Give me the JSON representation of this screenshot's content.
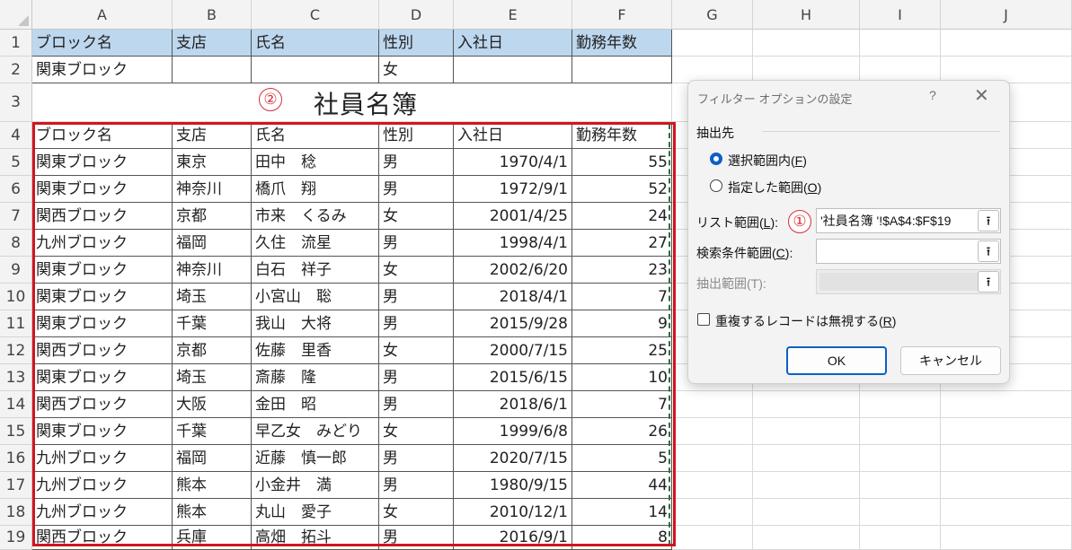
{
  "columns": [
    "A",
    "B",
    "C",
    "D",
    "E",
    "F",
    "G",
    "H",
    "I",
    "J"
  ],
  "rows": [
    "1",
    "2",
    "3",
    "4",
    "5",
    "6",
    "7",
    "8",
    "9",
    "10",
    "11",
    "12",
    "13",
    "14",
    "15",
    "16",
    "17",
    "18",
    "19"
  ],
  "criteria": {
    "headers": [
      "ブロック名",
      "支店",
      "氏名",
      "性別",
      "入社日",
      "勤務年数"
    ],
    "values": [
      "関東ブロック",
      "",
      "",
      "女",
      "",
      ""
    ]
  },
  "title": "社員名簿",
  "badge_title": "②",
  "table": {
    "headers": [
      "ブロック名",
      "支店",
      "氏名",
      "性別",
      "入社日",
      "勤務年数"
    ],
    "rows": [
      [
        "関東ブロック",
        "東京",
        "田中　稔",
        "男",
        "1970/4/1",
        "55"
      ],
      [
        "関東ブロック",
        "神奈川",
        "橋爪　翔",
        "男",
        "1972/9/1",
        "52"
      ],
      [
        "関西ブロック",
        "京都",
        "市来　くるみ",
        "女",
        "2001/4/25",
        "24"
      ],
      [
        "九州ブロック",
        "福岡",
        "久住　流星",
        "男",
        "1998/4/1",
        "27"
      ],
      [
        "関東ブロック",
        "神奈川",
        "白石　祥子",
        "女",
        "2002/6/20",
        "23"
      ],
      [
        "関東ブロック",
        "埼玉",
        "小宮山　聡",
        "男",
        "2018/4/1",
        "7"
      ],
      [
        "関東ブロック",
        "千葉",
        "我山　大将",
        "男",
        "2015/9/28",
        "9"
      ],
      [
        "関西ブロック",
        "京都",
        "佐藤　里香",
        "女",
        "2000/7/15",
        "25"
      ],
      [
        "関東ブロック",
        "埼玉",
        "斎藤　隆",
        "男",
        "2015/6/15",
        "10"
      ],
      [
        "関西ブロック",
        "大阪",
        "金田　昭",
        "男",
        "2018/6/1",
        "7"
      ],
      [
        "関東ブロック",
        "千葉",
        "早乙女　みどり",
        "女",
        "1999/6/8",
        "26"
      ],
      [
        "九州ブロック",
        "福岡",
        "近藤　慎一郎",
        "男",
        "2020/7/15",
        "5"
      ],
      [
        "九州ブロック",
        "熊本",
        "小金井　満",
        "男",
        "1980/9/15",
        "44"
      ],
      [
        "九州ブロック",
        "熊本",
        "丸山　愛子",
        "女",
        "2010/12/1",
        "14"
      ],
      [
        "関西ブロック",
        "兵庫",
        "高畑　拓斗",
        "男",
        "2016/9/1",
        "8"
      ]
    ]
  },
  "dialog": {
    "title": "フィルター オプションの設定",
    "help": "?",
    "close": "✕",
    "section_label": "抽出先",
    "radio1": {
      "text": "選択範囲内(",
      "key": "F",
      "tail": ")"
    },
    "radio2": {
      "text": "指定した範囲(",
      "key": "O",
      "tail": ")"
    },
    "list_range": {
      "text": "リスト範囲(",
      "key": "L",
      "tail": "):"
    },
    "list_range_value": "'社員名簿 '!$A$4:$F$19",
    "badge_list": "①",
    "criteria_range": {
      "text": "検索条件範囲(",
      "key": "C",
      "tail": "):"
    },
    "criteria_range_value": "",
    "extract_range": "抽出範囲(T):",
    "extract_range_value": "",
    "unique": {
      "text": "重複するレコードは無視する(",
      "key": "R",
      "tail": ")"
    },
    "ok": "OK",
    "cancel": "キャンセル",
    "collapse_glyph": "⭱"
  },
  "colors": {
    "accent": "#0e5fc5",
    "selection": "#d0161e",
    "header_fill": "#bdd7ee"
  }
}
